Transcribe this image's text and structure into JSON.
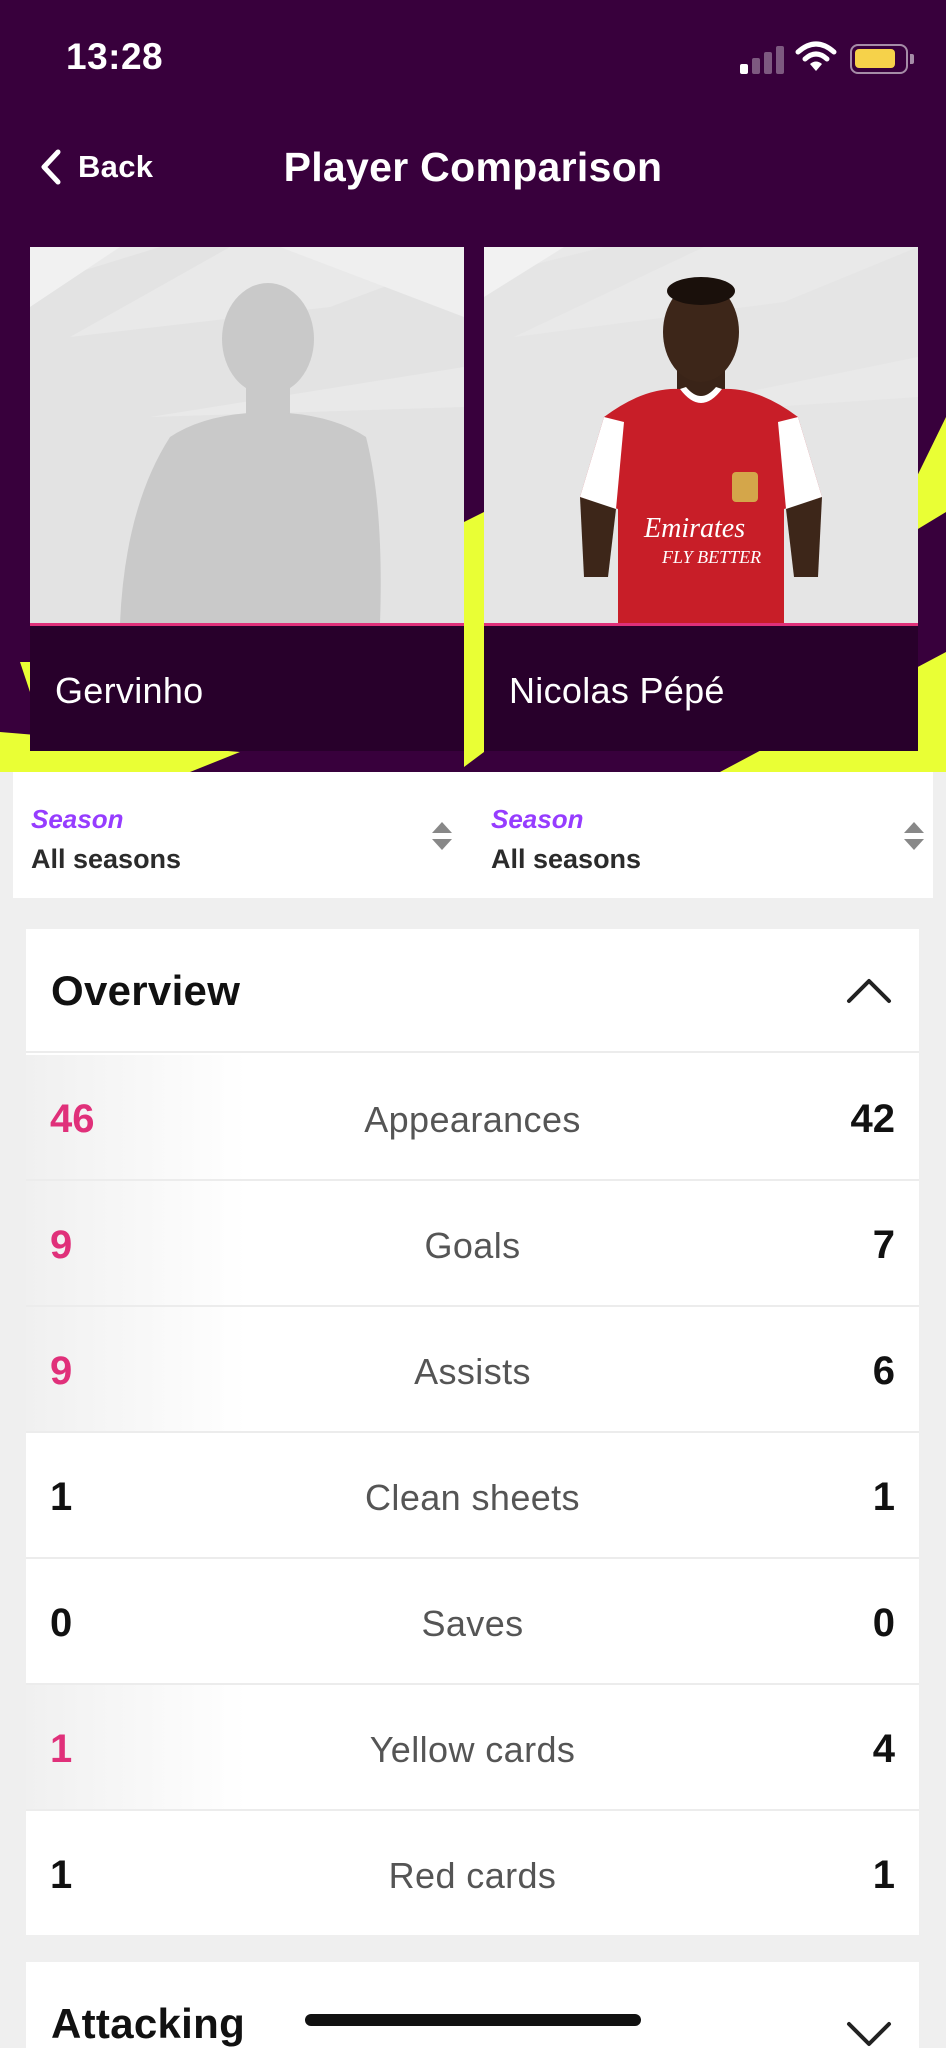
{
  "status_bar": {
    "time": "13:28"
  },
  "nav": {
    "back_label": "Back",
    "title": "Player Comparison"
  },
  "players": [
    {
      "name": "Gervinho"
    },
    {
      "name": "Nicolas Pépé",
      "shirt_text_1": "Emirates",
      "shirt_text_2": "FLY BETTER"
    }
  ],
  "seasons": [
    {
      "label": "Season",
      "value": "All seasons"
    },
    {
      "label": "Season",
      "value": "All seasons"
    }
  ],
  "overview": {
    "title": "Overview",
    "rows": [
      {
        "label": "Appearances",
        "left": "46",
        "right": "42",
        "left_better": true
      },
      {
        "label": "Goals",
        "left": "9",
        "right": "7",
        "left_better": true
      },
      {
        "label": "Assists",
        "left": "9",
        "right": "6",
        "left_better": true
      },
      {
        "label": "Clean sheets",
        "left": "1",
        "right": "1",
        "left_better": false
      },
      {
        "label": "Saves",
        "left": "0",
        "right": "0",
        "left_better": false
      },
      {
        "label": "Yellow cards",
        "left": "1",
        "right": "4",
        "left_better": true
      },
      {
        "label": "Red cards",
        "left": "1",
        "right": "1",
        "left_better": false
      }
    ]
  },
  "attacking": {
    "title": "Attacking"
  },
  "colors": {
    "brand_purple": "#38003c",
    "accent_pink": "#e0307a",
    "accent_lime": "#e9ff35",
    "season_purple": "#963cff"
  }
}
